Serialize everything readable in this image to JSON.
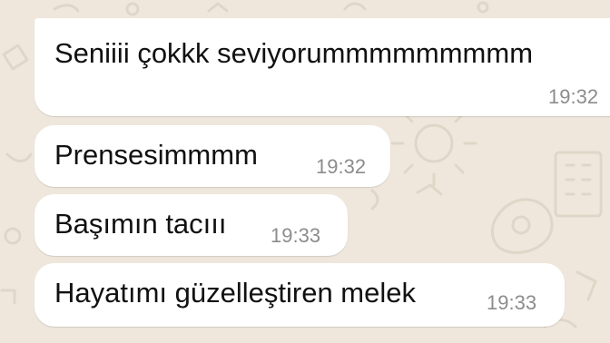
{
  "chat": {
    "background_color": "#efe7dc",
    "bubble_color": "#ffffff",
    "messages": [
      {
        "text": "Seniiii çokkk seviyorummmmmmmmm",
        "time": "19:32"
      },
      {
        "text": "Prensesimmmm",
        "time": "19:32"
      },
      {
        "text": "Başımın tacııı",
        "time": "19:33"
      },
      {
        "text": "Hayatımı güzelleştiren melek",
        "time": "19:33"
      }
    ]
  }
}
